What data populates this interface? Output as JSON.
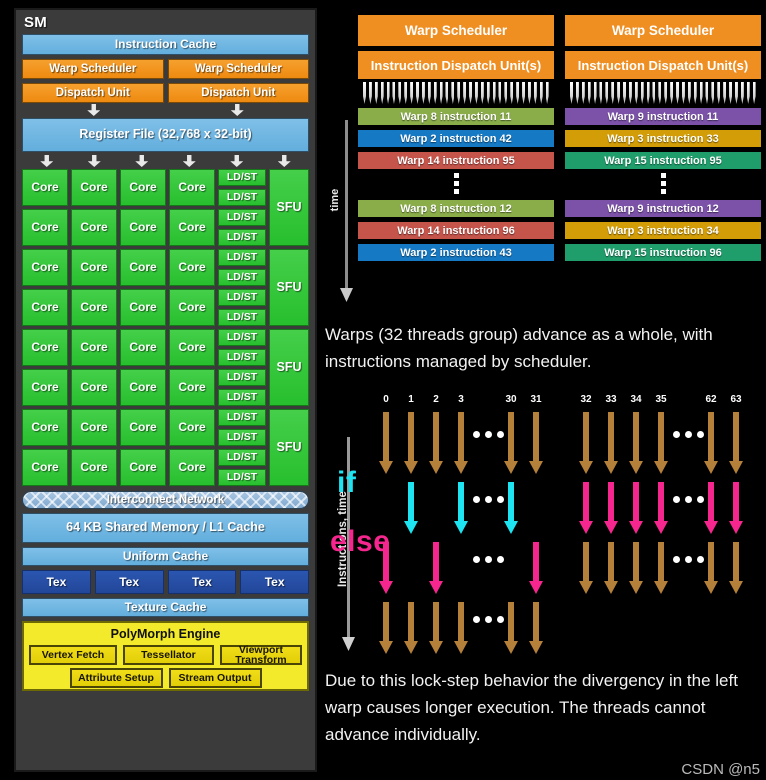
{
  "sm": {
    "title": "SM",
    "instruction_cache": "Instruction Cache",
    "warp_scheduler_left": "Warp Scheduler",
    "warp_scheduler_right": "Warp Scheduler",
    "dispatch_unit_left": "Dispatch Unit",
    "dispatch_unit_right": "Dispatch Unit",
    "register_file": "Register File (32,768 x 32-bit)",
    "core_label": "Core",
    "ldst_label": "LD/ST",
    "sfu_label": "SFU",
    "core_rows": 8,
    "cores_per_row": 4,
    "ldst_count": 16,
    "sfu_count": 4,
    "interconnect": "Interconnect Network",
    "shared_memory": "64 KB Shared Memory / L1 Cache",
    "uniform_cache": "Uniform Cache",
    "tex": [
      "Tex",
      "Tex",
      "Tex",
      "Tex"
    ],
    "texture_cache": "Texture Cache",
    "polymorph": {
      "title": "PolyMorph Engine",
      "row1": [
        "Vertex Fetch",
        "Tessellator",
        "Viewport Transform"
      ],
      "row2": [
        "Attribute Setup",
        "Stream Output"
      ]
    },
    "colors": {
      "panel_bg": "#3b3b3b",
      "blue": "#6fb6e3",
      "orange": "#ee8a10",
      "green": "#2dc433",
      "navy": "#2450a6",
      "yellow": "#f2ea2a",
      "yellow_button": "#e8d60d"
    }
  },
  "scheduler": {
    "time_axis_label": "time",
    "columns": [
      {
        "header": "Warp Scheduler",
        "subheader": "Instruction Dispatch Unit(s)",
        "rows_top": [
          {
            "label": "Warp 8 instruction 11",
            "color": "#8aad4a"
          },
          {
            "label": "Warp 2 instruction 42",
            "color": "#1579c4"
          },
          {
            "label": "Warp 14 instruction 95",
            "color": "#c5544b"
          }
        ],
        "rows_bottom": [
          {
            "label": "Warp 8 instruction 12",
            "color": "#8aad4a"
          },
          {
            "label": "Warp 14 instruction 96",
            "color": "#c5544b"
          },
          {
            "label": "Warp 2 instruction 43",
            "color": "#1579c4"
          }
        ]
      },
      {
        "header": "Warp Scheduler",
        "subheader": "Instruction Dispatch Unit(s)",
        "rows_top": [
          {
            "label": "Warp 9 instruction 11",
            "color": "#7b52a8"
          },
          {
            "label": "Warp 3 instruction 33",
            "color": "#d29d06"
          },
          {
            "label": "Warp 15 instruction 95",
            "color": "#1f9d6b"
          }
        ],
        "rows_bottom": [
          {
            "label": "Warp 9 instruction 12",
            "color": "#7b52a8"
          },
          {
            "label": "Warp 3 instruction 34",
            "color": "#d29d06"
          },
          {
            "label": "Warp 15 instruction 96",
            "color": "#1f9d6b"
          }
        ]
      }
    ]
  },
  "paragraph1": "Warps (32 threads group) advance as a whole, with instructions managed by scheduler.",
  "divergence": {
    "axis_label": "Instructions, time",
    "if_label": "if",
    "else_label": "else",
    "left_warp_threads": [
      "0",
      "1",
      "2",
      "3",
      "30",
      "31"
    ],
    "right_warp_threads": [
      "32",
      "33",
      "34",
      "35",
      "62",
      "63"
    ],
    "rows": [
      {
        "name": "pre",
        "left": [
          "brown",
          "brown",
          "brown",
          "brown",
          "brown",
          "brown"
        ],
        "right": [
          "brown",
          "brown",
          "brown",
          "brown",
          "brown",
          "brown"
        ]
      },
      {
        "name": "if",
        "left": [
          "none",
          "cyan",
          "none",
          "cyan",
          "cyan",
          "none"
        ],
        "right": [
          "pink",
          "pink",
          "pink",
          "pink",
          "pink",
          "pink"
        ]
      },
      {
        "name": "else",
        "left": [
          "pink",
          "none",
          "pink",
          "none",
          "none",
          "pink"
        ],
        "right": [
          "brown",
          "brown",
          "brown",
          "brown",
          "brown",
          "brown"
        ]
      },
      {
        "name": "post",
        "left": [
          "brown",
          "brown",
          "brown",
          "brown",
          "brown",
          "brown"
        ],
        "right": [
          "none",
          "none",
          "none",
          "none",
          "none",
          "none"
        ]
      }
    ],
    "colors": {
      "brown": "#b5803a",
      "cyan": "#1ee3f0",
      "pink": "#f6268f"
    }
  },
  "paragraph2": "Due to this lock-step behavior the divergency in the left warp causes longer execution. The threads cannot advance individually.",
  "watermark": "CSDN @n5"
}
